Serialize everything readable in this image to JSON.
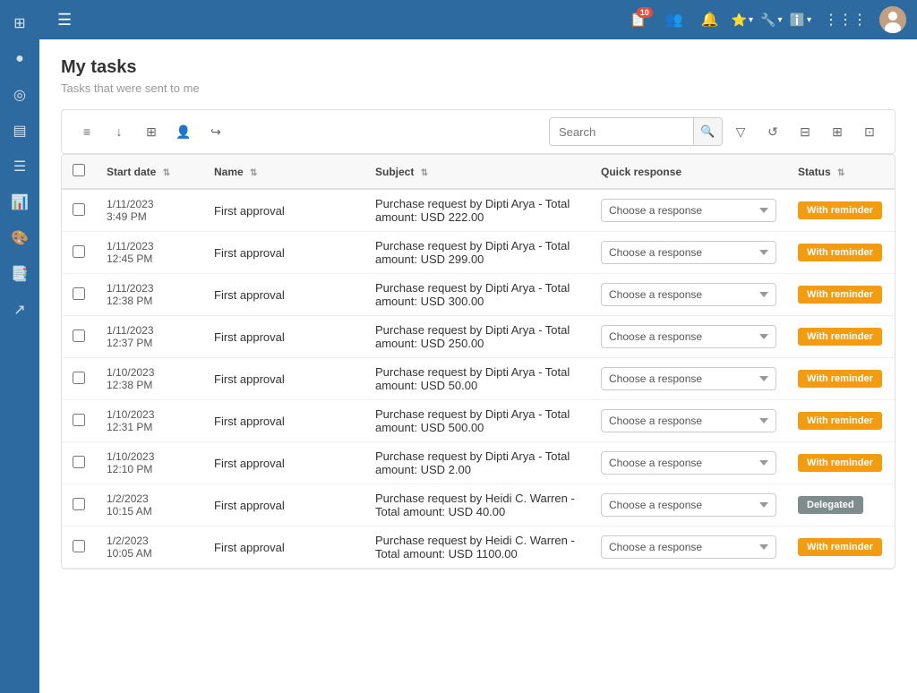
{
  "app": {
    "title": "My tasks",
    "subtitle": "Tasks that were sent to me"
  },
  "topnav": {
    "hamburger_icon": "☰",
    "badge_count": "10",
    "icons": [
      "📋",
      "👥",
      "🔔",
      "⭐",
      "🔧",
      "ℹ️",
      "⋮⋮⋮"
    ]
  },
  "sidebar": {
    "items": [
      {
        "icon": "⊞",
        "name": "grid-icon"
      },
      {
        "icon": "◉",
        "name": "circle-icon"
      },
      {
        "icon": "◎",
        "name": "target-icon"
      },
      {
        "icon": "📥",
        "name": "inbox-icon"
      },
      {
        "icon": "☰",
        "name": "list-icon"
      },
      {
        "icon": "📊",
        "name": "chart-icon"
      },
      {
        "icon": "🎨",
        "name": "palette-icon"
      },
      {
        "icon": "📑",
        "name": "report-icon"
      },
      {
        "icon": "↗",
        "name": "share-icon"
      }
    ]
  },
  "toolbar": {
    "search_placeholder": "Search",
    "buttons": [
      {
        "icon": "≡",
        "name": "list-view-btn"
      },
      {
        "icon": "↓",
        "name": "download-btn"
      },
      {
        "icon": "⊞",
        "name": "grid-btn"
      },
      {
        "icon": "👤",
        "name": "user-btn"
      },
      {
        "icon": "↪",
        "name": "forward-btn"
      }
    ],
    "right_buttons": [
      {
        "icon": "▽",
        "name": "filter-btn"
      },
      {
        "icon": "↺",
        "name": "refresh-btn"
      },
      {
        "icon": "⊟",
        "name": "collapse-btn"
      },
      {
        "icon": "⊞",
        "name": "view-btn"
      },
      {
        "icon": "⊡",
        "name": "options-btn"
      }
    ]
  },
  "table": {
    "columns": [
      {
        "label": "",
        "key": "checkbox"
      },
      {
        "label": "Start date",
        "key": "start_date",
        "sortable": true
      },
      {
        "label": "Name",
        "key": "name",
        "sortable": true
      },
      {
        "label": "Subject",
        "key": "subject",
        "sortable": true
      },
      {
        "label": "Quick response",
        "key": "quick_response"
      },
      {
        "label": "Status",
        "key": "status",
        "sortable": true
      }
    ],
    "rows": [
      {
        "start_date": "1/11/2023\n3:49 PM",
        "name": "First approval",
        "subject": "Purchase request by Dipti Arya - Total amount: USD 222.00",
        "quick_response": "Choose a response",
        "status": "With reminder",
        "status_type": "reminder"
      },
      {
        "start_date": "1/11/2023\n12:45 PM",
        "name": "First approval",
        "subject": "Purchase request by Dipti Arya - Total amount: USD 299.00",
        "quick_response": "Choose a response",
        "status": "With reminder",
        "status_type": "reminder"
      },
      {
        "start_date": "1/11/2023\n12:38 PM",
        "name": "First approval",
        "subject": "Purchase request by Dipti Arya - Total amount: USD 300.00",
        "quick_response": "Choose a response",
        "status": "With reminder",
        "status_type": "reminder"
      },
      {
        "start_date": "1/11/2023\n12:37 PM",
        "name": "First approval",
        "subject": "Purchase request by Dipti Arya - Total amount: USD 250.00",
        "quick_response": "Choose a response",
        "status": "With reminder",
        "status_type": "reminder"
      },
      {
        "start_date": "1/10/2023\n12:38 PM",
        "name": "First approval",
        "subject": "Purchase request by Dipti Arya - Total amount: USD 50.00",
        "quick_response": "Choose a response",
        "status": "With reminder",
        "status_type": "reminder"
      },
      {
        "start_date": "1/10/2023\n12:31 PM",
        "name": "First approval",
        "subject": "Purchase request by Dipti Arya - Total amount: USD 500.00",
        "quick_response": "Choose a response",
        "status": "With reminder",
        "status_type": "reminder"
      },
      {
        "start_date": "1/10/2023\n12:10 PM",
        "name": "First approval",
        "subject": "Purchase request by Dipti Arya - Total amount: USD 2.00",
        "quick_response": "Choose a response",
        "status": "With reminder",
        "status_type": "reminder"
      },
      {
        "start_date": "1/2/2023\n10:15 AM",
        "name": "First approval",
        "subject": "Purchase request by Heidi C. Warren - Total amount: USD 40.00",
        "quick_response": "Choose a response",
        "status": "Delegated",
        "status_type": "delegated"
      },
      {
        "start_date": "1/2/2023\n10:05 AM",
        "name": "First approval",
        "subject": "Purchase request by Heidi C. Warren - Total amount: USD 1100.00",
        "quick_response": "Choose a response",
        "status": "With reminder",
        "status_type": "reminder"
      }
    ]
  }
}
